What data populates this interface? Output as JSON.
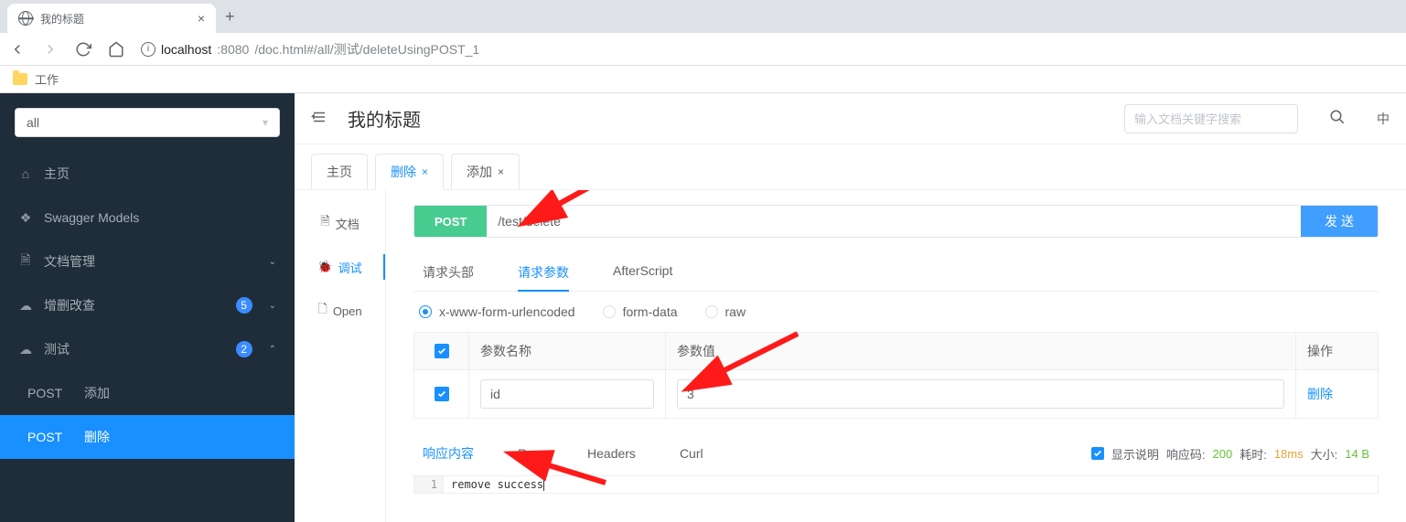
{
  "browser": {
    "tab_title": "我的标题",
    "new_tab": "+",
    "url_host": "localhost",
    "url_port": ":8080",
    "url_path": "/doc.html#/all/测试/deleteUsingPOST_1",
    "bookmark": "工作"
  },
  "sidebar": {
    "select_value": "all",
    "items": [
      {
        "icon": "home",
        "label": "主页"
      },
      {
        "icon": "cube",
        "label": "Swagger Models"
      },
      {
        "icon": "doc",
        "label": "文档管理",
        "expandable": true
      },
      {
        "icon": "cloud",
        "label": "增删改查",
        "badge": "5",
        "expandable": true
      },
      {
        "icon": "cloud",
        "label": "测试",
        "badge": "2",
        "expandable": true,
        "expanded": true
      }
    ],
    "sub_items": [
      {
        "method": "POST",
        "label": "添加"
      },
      {
        "method": "POST",
        "label": "删除",
        "active": true
      }
    ]
  },
  "header": {
    "title": "我的标题",
    "search_placeholder": "输入文档关键字搜索",
    "lang": "中"
  },
  "tabs": [
    {
      "label": "主页",
      "closable": false
    },
    {
      "label": "删除",
      "closable": true,
      "active": true
    },
    {
      "label": "添加",
      "closable": true
    }
  ],
  "side_tabs": [
    {
      "icon": "doc",
      "label": "文档"
    },
    {
      "icon": "bug",
      "label": "调试",
      "active": true
    },
    {
      "icon": "open",
      "label": "Open"
    }
  ],
  "request": {
    "method": "POST",
    "url": "/test/delete",
    "send": "发 送"
  },
  "sub_tabs": [
    {
      "label": "请求头部"
    },
    {
      "label": "请求参数",
      "active": true
    },
    {
      "label": "AfterScript"
    }
  ],
  "body_types": [
    {
      "label": "x-www-form-urlencoded",
      "checked": true
    },
    {
      "label": "form-data"
    },
    {
      "label": "raw"
    }
  ],
  "params_table": {
    "headers": {
      "name": "参数名称",
      "value": "参数值",
      "op": "操作"
    },
    "rows": [
      {
        "checked": true,
        "name": "id",
        "value": "3",
        "op": "删除"
      }
    ]
  },
  "response": {
    "tabs": [
      {
        "label": "响应内容",
        "active": true
      },
      {
        "label": "Raw"
      },
      {
        "label": "Headers"
      },
      {
        "label": "Curl"
      }
    ],
    "show_desc_label": "显示说明",
    "code_label": "响应码:",
    "code_value": "200",
    "time_label": "耗时:",
    "time_value": "18ms",
    "size_label": "大小:",
    "size_value": "14 B",
    "body_line": "1",
    "body": "remove success"
  }
}
